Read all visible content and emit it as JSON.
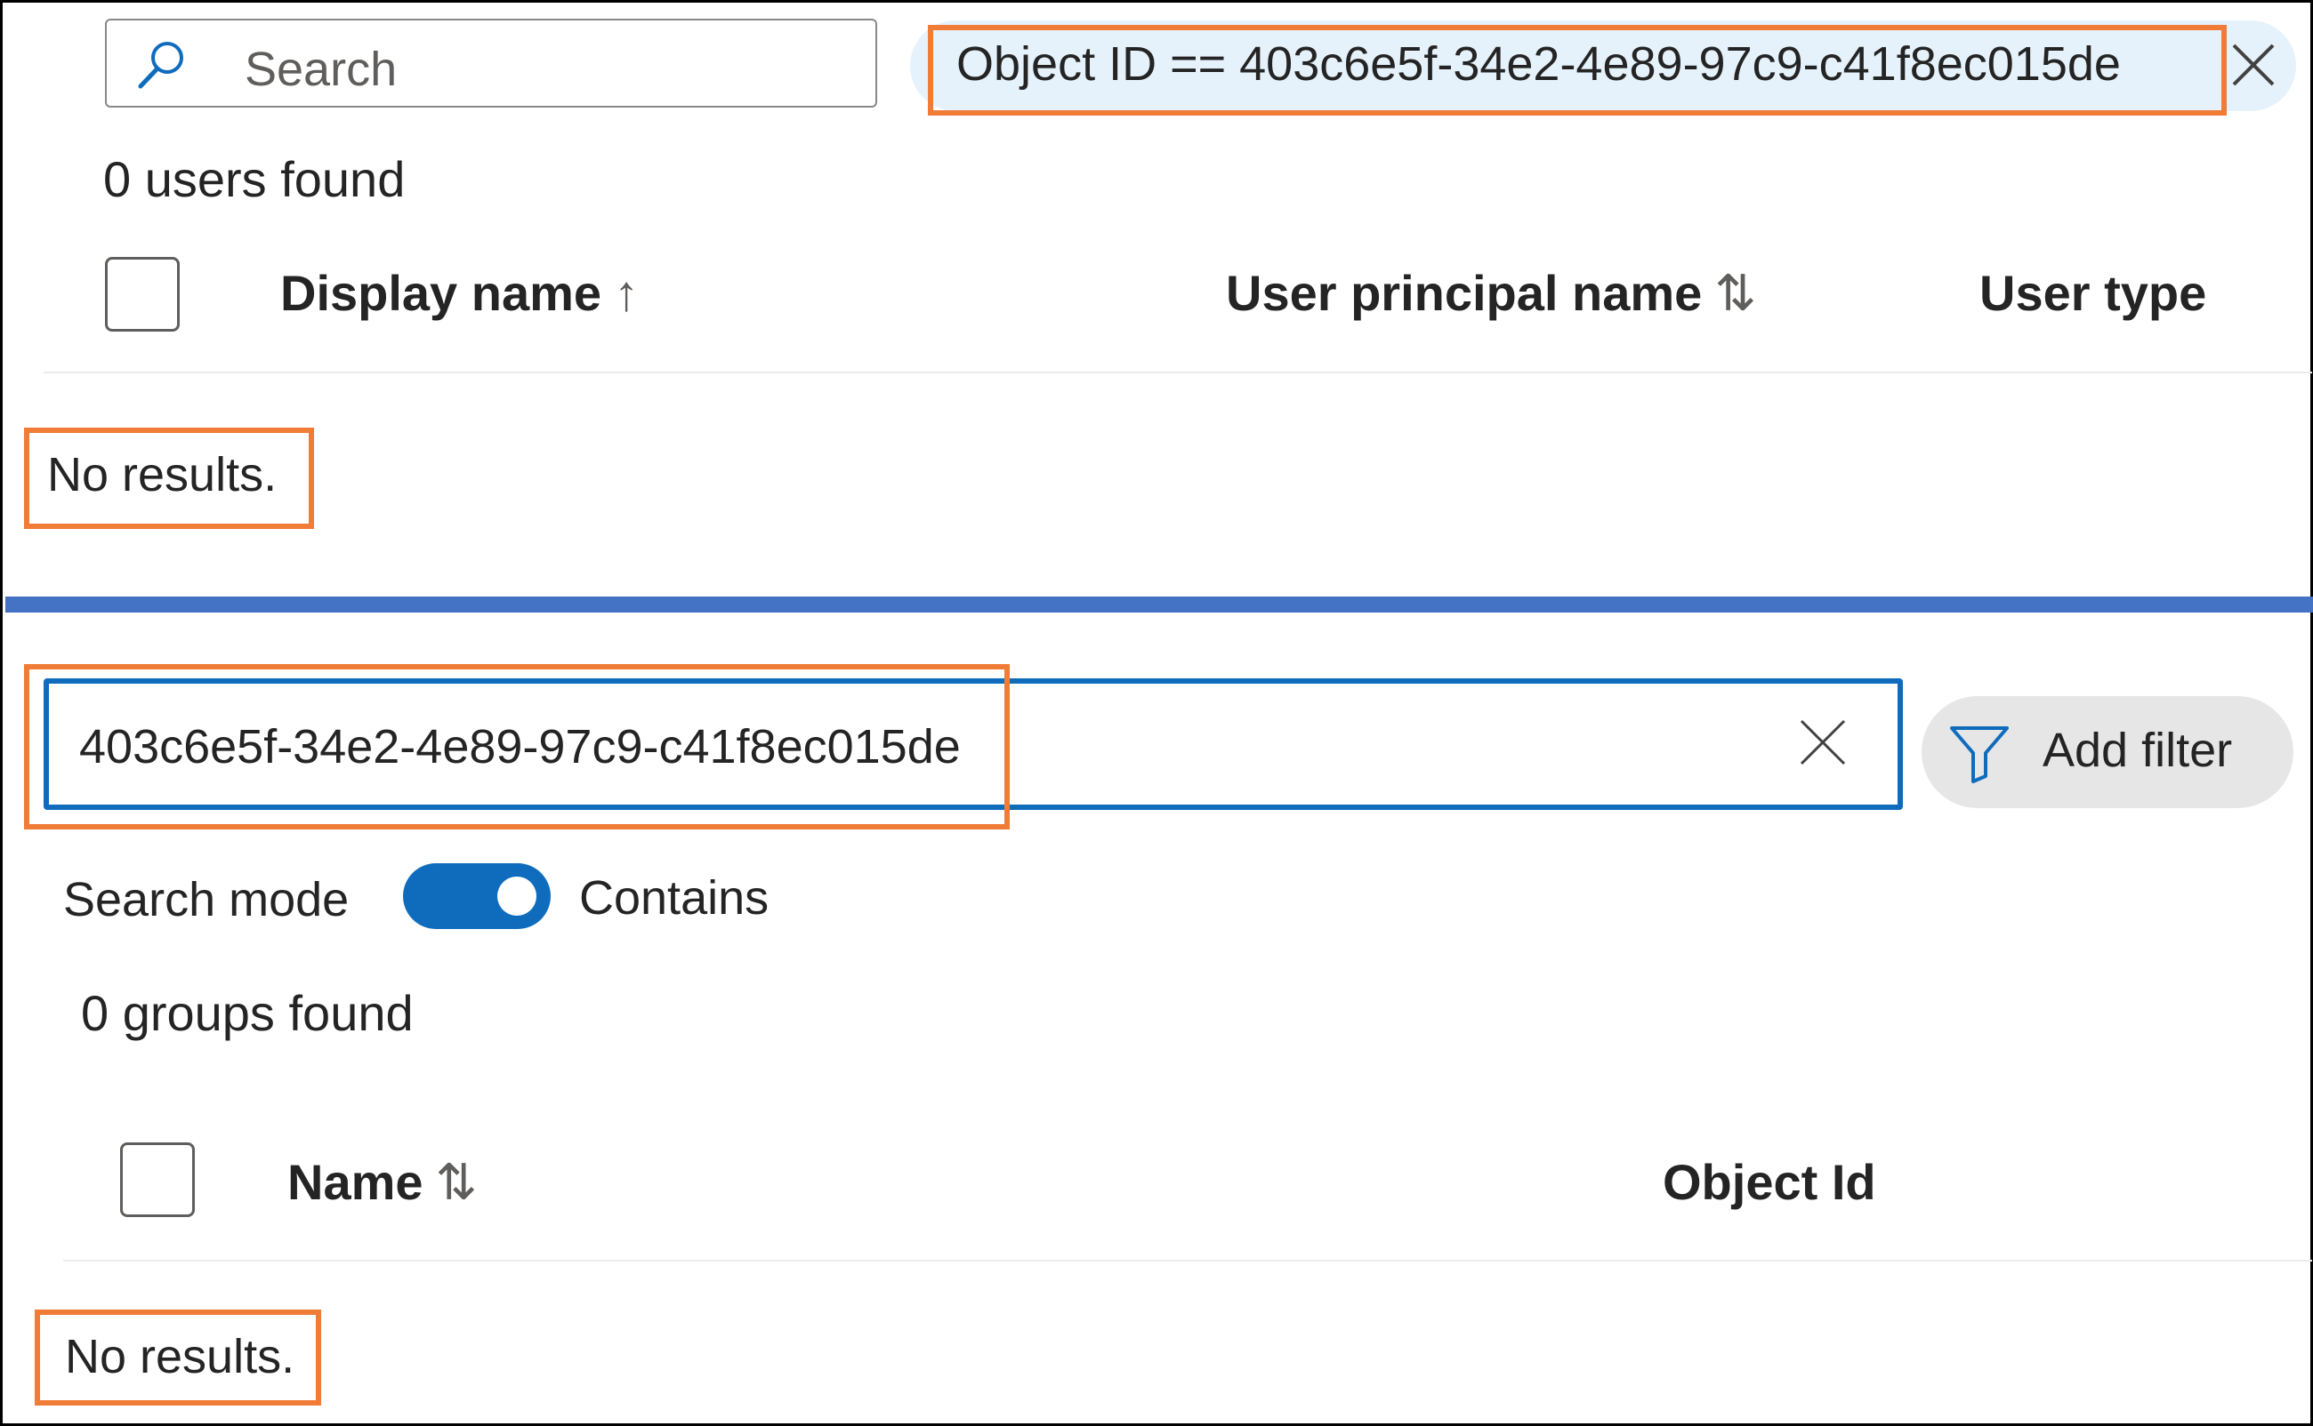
{
  "users_panel": {
    "search": {
      "placeholder": "Search",
      "icon": "search-icon"
    },
    "active_filter": {
      "text": "Object ID == 403c6e5f-34e2-4e89-97c9-c41f8ec015de",
      "remove_icon": "close-icon"
    },
    "result_count": "0 users found",
    "columns": [
      {
        "label": "Display name",
        "sort_glyph": "↑"
      },
      {
        "label": "User principal name",
        "sort_glyph": "⇅"
      },
      {
        "label": "User type"
      }
    ],
    "empty_message": "No results."
  },
  "groups_panel": {
    "search": {
      "value": "403c6e5f-34e2-4e89-97c9-c41f8ec015de",
      "clear_icon": "close-icon"
    },
    "add_filter_label": "Add filter",
    "search_mode": {
      "label": "Search mode",
      "value": "Contains",
      "enabled": true
    },
    "result_count": "0 groups found",
    "columns": [
      {
        "label": "Name",
        "sort_glyph": "⇅"
      },
      {
        "label": "Object Id"
      }
    ],
    "empty_message": "No results."
  },
  "colors": {
    "highlight": "#f07c37",
    "accent": "#0f6cbd",
    "divider": "#4472c4",
    "filter_pill_bg": "#e6f2fb"
  }
}
